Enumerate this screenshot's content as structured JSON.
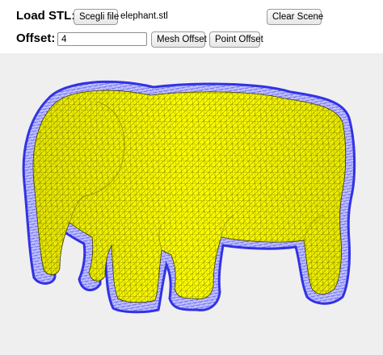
{
  "toolbar": {
    "load_label": "Load STL:",
    "choose_file_label": "Scegli file",
    "file_name": "elephant.stl",
    "clear_label": "Clear Scene",
    "offset_label": "Offset:",
    "offset_value": "4",
    "mesh_offset_label": "Mesh Offset",
    "point_offset_label": "Point Offset"
  },
  "viewport": {
    "background_color": "#efefef",
    "mesh_color": "#ffff00",
    "wire_color": "#5a5a00",
    "offset_color": "#3c3cf0"
  }
}
